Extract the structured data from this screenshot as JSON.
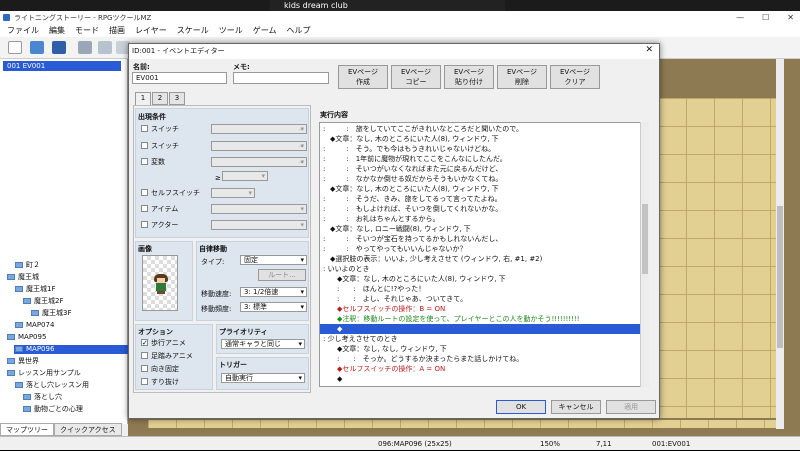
{
  "banner": {
    "text": "kids dream club"
  },
  "window": {
    "title": "ライトニングストーリー - RPGツクールMZ",
    "controls": [
      "—",
      "☐",
      "✕"
    ]
  },
  "menu": [
    "ファイル",
    "編集",
    "モード",
    "描画",
    "レイヤー",
    "スケール",
    "ツール",
    "ゲーム",
    "ヘルプ"
  ],
  "toolbar": {
    "icons": [
      "new-icon",
      "open-icon",
      "save-icon",
      "cut-icon",
      "copy-icon",
      "paste-icon"
    ]
  },
  "tree": {
    "selected_event": "001 EV001",
    "items": [
      {
        "indent": 1,
        "label": "町２",
        "selected": false
      },
      {
        "indent": 0,
        "label": "魔王城",
        "selected": false
      },
      {
        "indent": 1,
        "label": "魔王城1F",
        "selected": false
      },
      {
        "indent": 2,
        "label": "魔王城2F",
        "selected": false
      },
      {
        "indent": 3,
        "label": "魔王城3F",
        "selected": false
      },
      {
        "indent": 1,
        "label": "MAP074",
        "selected": false
      },
      {
        "indent": 0,
        "label": "MAP095",
        "selected": false
      },
      {
        "indent": 1,
        "label": "MAP096",
        "selected": true
      },
      {
        "indent": 0,
        "label": "異世界",
        "selected": false
      },
      {
        "indent": 0,
        "label": "レッスン用サンプル",
        "selected": false
      },
      {
        "indent": 1,
        "label": "落とし穴レッスン用",
        "selected": false
      },
      {
        "indent": 2,
        "label": "落とし穴",
        "selected": false
      },
      {
        "indent": 2,
        "label": "動物ごとの心理",
        "selected": false
      }
    ],
    "tabs": [
      "マップツリー",
      "クイックアクセス"
    ]
  },
  "status": {
    "map": "096:MAP096 (25x25)",
    "zoom": "150%",
    "coords": "7,11",
    "event": "001:EV001"
  },
  "dialog": {
    "title": "ID:001 - イベントエディター",
    "name_label": "名前:",
    "name_value": "EV001",
    "memo_label": "メモ:",
    "memo_value": "",
    "ev_buttons": [
      {
        "line1": "EVページ",
        "line2": "作成"
      },
      {
        "line1": "EVページ",
        "line2": "コピー"
      },
      {
        "line1": "EVページ",
        "line2": "貼り付け"
      },
      {
        "line1": "EVページ",
        "line2": "削除"
      },
      {
        "line1": "EVページ",
        "line2": "クリア"
      }
    ],
    "tabs": [
      "1",
      "2",
      "3"
    ],
    "conditions": {
      "heading": "出現条件",
      "switch1": "スイッチ",
      "switch2": "スイッチ",
      "variable": "変数",
      "gte": "≥",
      "self_switch": "セルフスイッチ",
      "item": "アイテム",
      "actor": "アクター"
    },
    "image": {
      "heading": "画像"
    },
    "autonomous": {
      "heading": "自律移動",
      "type_label": "タイプ:",
      "type_value": "固定",
      "route_button": "ルート...",
      "speed_label": "移動速度:",
      "speed_value": "3: 1/2倍速",
      "freq_label": "移動頻度:",
      "freq_value": "3: 標準"
    },
    "options": {
      "heading": "オプション",
      "items": [
        {
          "label": "歩行アニメ",
          "checked": true
        },
        {
          "label": "足踏みアニメ",
          "checked": false
        },
        {
          "label": "向き固定",
          "checked": false
        },
        {
          "label": "すり抜け",
          "checked": false
        }
      ]
    },
    "priority": {
      "heading": "プライオリティ",
      "value": "通常キャラと同じ"
    },
    "trigger": {
      "heading": "トリガー",
      "value": "自動実行"
    },
    "contents": {
      "heading": "実行内容",
      "lines": [
        {
          "text": ":　　　:　旅をしていてここがきれいなところだと聞いたので。",
          "color": "#111",
          "selected": false
        },
        {
          "text": "　◆文章：なし, 木のところにいた人(8), ウィンドウ, 下",
          "color": "#111",
          "selected": false
        },
        {
          "text": ":　　　:　そう。でも今はもうきれいじゃないけどね。",
          "color": "#111",
          "selected": false
        },
        {
          "text": ":　　　:　1年前に魔物が現れてここをこんなにしたんだ。",
          "color": "#111",
          "selected": false
        },
        {
          "text": ":　　　:　そいつがいなくなればまた元に戻るんだけど、",
          "color": "#111",
          "selected": false
        },
        {
          "text": ":　　　:　なかなか倒せる奴だからそうもいかなくてね。",
          "color": "#111",
          "selected": false
        },
        {
          "text": "　◆文章：なし, 木のところにいた人(8), ウィンドウ, 下",
          "color": "#111",
          "selected": false
        },
        {
          "text": ":　　　:　そうだ、きみ、旅をしてるって言ってたよね。",
          "color": "#111",
          "selected": false
        },
        {
          "text": ":　　　:　もしよければ、そいつを倒してくれないかな。",
          "color": "#111",
          "selected": false
        },
        {
          "text": ":　　　:　お礼はちゃんとするから。",
          "color": "#111",
          "selected": false
        },
        {
          "text": "　◆文章：なし, ロニー戦闘(8), ウィンドウ, 下",
          "color": "#111",
          "selected": false
        },
        {
          "text": ":　　　:　そいつが宝石を持ってるかもしれないんだし、",
          "color": "#111",
          "selected": false
        },
        {
          "text": ":　　　:　やってやってもいいんじゃないか？",
          "color": "#111",
          "selected": false
        },
        {
          "text": "　◆選択肢の表示：いいよ, 少し考えさせて (ウィンドウ, 右, #1, #2)",
          "color": "#111",
          "selected": false
        },
        {
          "text": ": いいよのとき",
          "color": "#111",
          "selected": false
        },
        {
          "text": "　　◆文章：なし, 木のところにいた人(8), ウィンドウ, 下",
          "color": "#111",
          "selected": false
        },
        {
          "text": "　　:　　:　ほんとに!?やった！",
          "color": "#111",
          "selected": false
        },
        {
          "text": "　　:　　:　よし、それじゃあ、ついてきて。",
          "color": "#111",
          "selected": false
        },
        {
          "text": "　　◆セルフスイッチの操作：B = ON",
          "color": "#c01818",
          "selected": false
        },
        {
          "text": "　　◆注釈：移動ルートの設定を使って、プレイヤーとこの人を動かそう!!!!!!!!!!",
          "color": "#1a8a1a",
          "selected": false
        },
        {
          "text": "　　◆",
          "color": "#fff",
          "selected": true
        },
        {
          "text": ": 少し考えさせてのとき",
          "color": "#111",
          "selected": false
        },
        {
          "text": "　　◆文章：なし, なし, ウィンドウ, 下",
          "color": "#111",
          "selected": false
        },
        {
          "text": "　　:　　:　そっか。どうするか決まったらまた話しかけてね。",
          "color": "#111",
          "selected": false
        },
        {
          "text": "　　◆セルフスイッチの操作：A = ON",
          "color": "#c01818",
          "selected": false
        },
        {
          "text": "　　◆",
          "color": "#111",
          "selected": false
        }
      ]
    },
    "buttons": {
      "ok": "OK",
      "cancel": "キャンセル",
      "apply": "適用"
    }
  }
}
